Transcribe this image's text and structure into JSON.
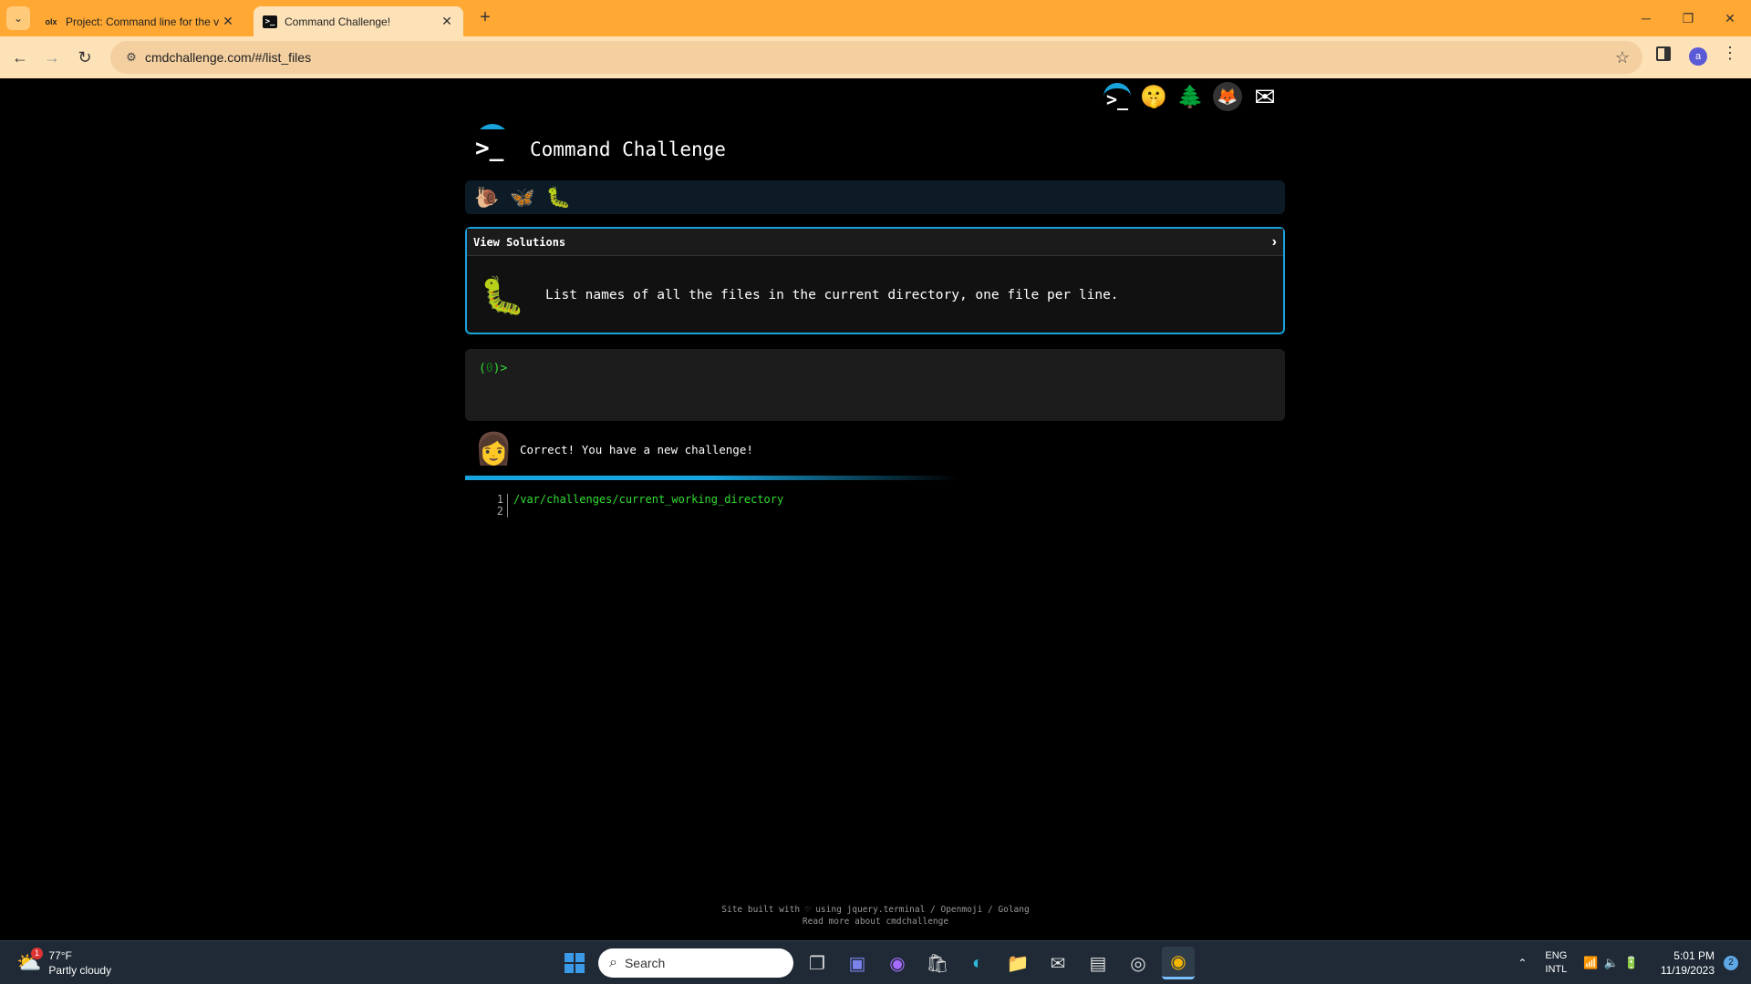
{
  "browser": {
    "tabs": [
      {
        "title": "Project: Command line for the v",
        "favicon": "olx",
        "active": false
      },
      {
        "title": "Command Challenge!",
        "favicon": ">_",
        "active": true
      }
    ],
    "url": "cmdchallenge.com/#/list_files",
    "profile_initial": "a"
  },
  "header": {
    "title": "Command Challenge",
    "top_icons": [
      "terminal-logo-icon",
      "emoji-icon",
      "tree-icon",
      "gitlab-icon",
      "mail-icon"
    ]
  },
  "progress": {
    "items": [
      "snail-icon",
      "butterfly-icon",
      "caterpillar-icon"
    ]
  },
  "challenge": {
    "solutions_label": "View Solutions",
    "description": "List names of all the files in the current directory, one file per line."
  },
  "terminal": {
    "score": "0",
    "prompt_open": "(",
    "prompt_close": ")>"
  },
  "feedback": {
    "message": "Correct! You have a new challenge!"
  },
  "output": {
    "lines": [
      {
        "number": "1",
        "text": "/var/challenges/current_working_directory"
      },
      {
        "number": "2",
        "text": ""
      }
    ]
  },
  "footer": {
    "line1": "Site built with ♡ using jquery.terminal / Openmoji / Golang",
    "line2": "Read more about cmdchallenge"
  },
  "taskbar": {
    "weather_temp": "77°F",
    "weather_desc": "Partly cloudy",
    "weather_badge": "1",
    "search_placeholder": "Search",
    "lang_line1": "ENG",
    "lang_line2": "INTL",
    "time": "5:01 PM",
    "date": "11/19/2023",
    "notifications": "2"
  },
  "colors": {
    "accent": "#19a3dc",
    "terminal_green": "#33dd33",
    "tabbar": "#ffa834"
  }
}
